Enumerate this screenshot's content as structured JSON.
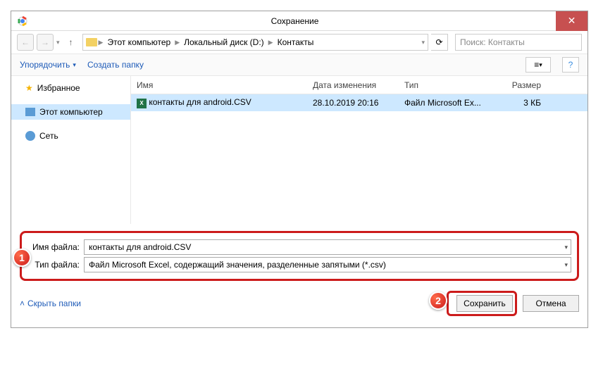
{
  "window": {
    "title": "Сохранение"
  },
  "nav": {
    "breadcrumb": [
      "Этот компьютер",
      "Локальный диск (D:)",
      "Контакты"
    ],
    "search_placeholder": "Поиск: Контакты"
  },
  "toolbar": {
    "organize": "Упорядочить",
    "newfolder": "Создать папку"
  },
  "tree": {
    "favorites": "Избранное",
    "computer": "Этот компьютер",
    "network": "Сеть"
  },
  "columns": {
    "name": "Имя",
    "date": "Дата изменения",
    "type": "Тип",
    "size": "Размер"
  },
  "files": [
    {
      "name": "контакты для android.CSV",
      "date": "28.10.2019 20:16",
      "type": "Файл Microsoft Ex...",
      "size": "3 КБ"
    }
  ],
  "form": {
    "filename_label": "Имя файла:",
    "filename_value": "контакты для android.CSV",
    "filetype_label": "Тип файла:",
    "filetype_value": "Файл Microsoft Excel, содержащий значения, разделенные запятыми (*.csv)"
  },
  "footer": {
    "hide": "Скрыть папки",
    "save": "Сохранить",
    "cancel": "Отмена"
  },
  "markers": {
    "one": "1",
    "two": "2"
  }
}
